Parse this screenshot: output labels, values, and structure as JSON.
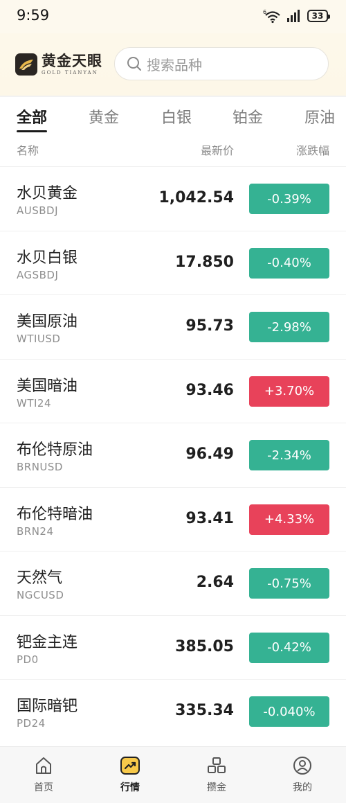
{
  "status_bar": {
    "time": "9:59",
    "battery": "33"
  },
  "header": {
    "logo_cn": "黄金天眼",
    "logo_en": "GOLD TIANYAN",
    "search_placeholder": "搜索品种"
  },
  "tabs": [
    {
      "label": "全部",
      "active": true
    },
    {
      "label": "黄金",
      "active": false
    },
    {
      "label": "白银",
      "active": false
    },
    {
      "label": "铂金",
      "active": false
    },
    {
      "label": "原油",
      "active": false
    }
  ],
  "columns": {
    "name": "名称",
    "price": "最新价",
    "change": "涨跌幅"
  },
  "colors": {
    "down": "#35b293",
    "up": "#e8425a"
  },
  "rows": [
    {
      "name": "水贝黄金",
      "code": "AUSBDJ",
      "price": "1,042.54",
      "change": "-0.39%",
      "direction": "down"
    },
    {
      "name": "水贝白银",
      "code": "AGSBDJ",
      "price": "17.850",
      "change": "-0.40%",
      "direction": "down"
    },
    {
      "name": "美国原油",
      "code": "WTIUSD",
      "price": "95.73",
      "change": "-2.98%",
      "direction": "down"
    },
    {
      "name": "美国暗油",
      "code": "WTI24",
      "price": "93.46",
      "change": "+3.70%",
      "direction": "up"
    },
    {
      "name": "布伦特原油",
      "code": "BRNUSD",
      "price": "96.49",
      "change": "-2.34%",
      "direction": "down"
    },
    {
      "name": "布伦特暗油",
      "code": "BRN24",
      "price": "93.41",
      "change": "+4.33%",
      "direction": "up"
    },
    {
      "name": "天然气",
      "code": "NGCUSD",
      "price": "2.64",
      "change": "-0.75%",
      "direction": "down"
    },
    {
      "name": "钯金主连",
      "code": "PD0",
      "price": "385.05",
      "change": "-0.42%",
      "direction": "down"
    },
    {
      "name": "国际暗钯",
      "code": "PD24",
      "price": "335.34",
      "change": "-0.040%",
      "direction": "down"
    }
  ],
  "bottom_nav": [
    {
      "label": "首页",
      "icon": "home-icon",
      "active": false
    },
    {
      "label": "行情",
      "icon": "market-trend-icon",
      "active": true
    },
    {
      "label": "攒金",
      "icon": "gold-bars-icon",
      "active": false
    },
    {
      "label": "我的",
      "icon": "profile-icon",
      "active": false
    }
  ]
}
